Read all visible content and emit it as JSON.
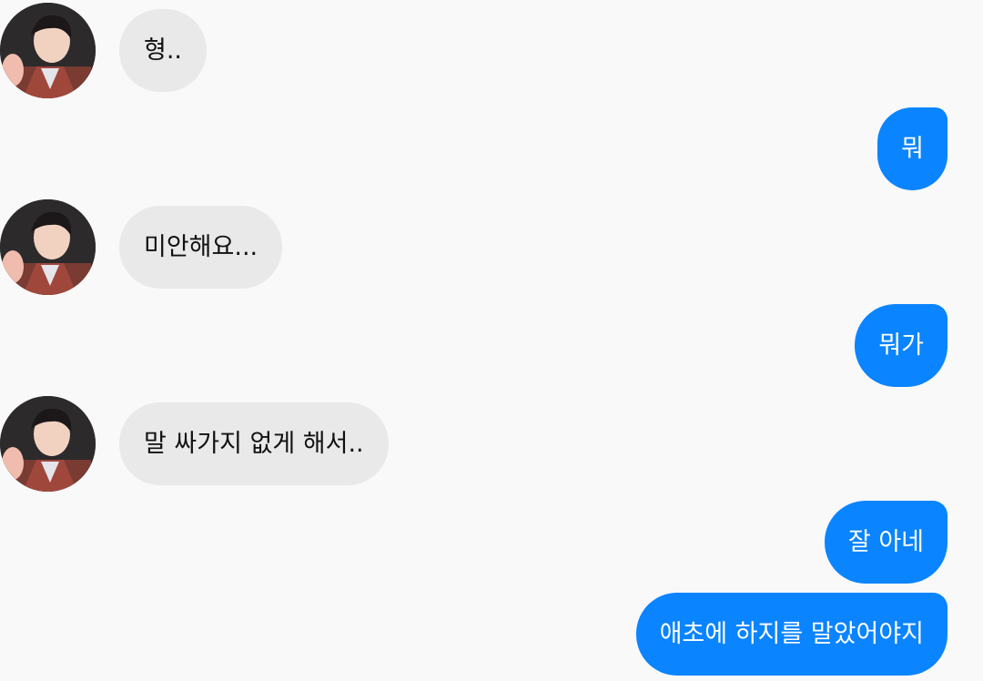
{
  "colors": {
    "background": "#f9f9f9",
    "incoming_bubble": "#e9e9e9",
    "outgoing_bubble": "#0a84ff",
    "incoming_text": "#111111",
    "outgoing_text": "#ffffff"
  },
  "messages": [
    {
      "direction": "incoming",
      "text": "형.."
    },
    {
      "direction": "outgoing",
      "text": "뭐"
    },
    {
      "direction": "incoming",
      "text": "미안해요..."
    },
    {
      "direction": "outgoing",
      "text": "뭐가"
    },
    {
      "direction": "incoming",
      "text": "말 싸가지 없게 해서.."
    },
    {
      "direction": "outgoing",
      "text": "잘 아네"
    },
    {
      "direction": "outgoing",
      "text": "애초에 하지를 말았어야지"
    }
  ]
}
